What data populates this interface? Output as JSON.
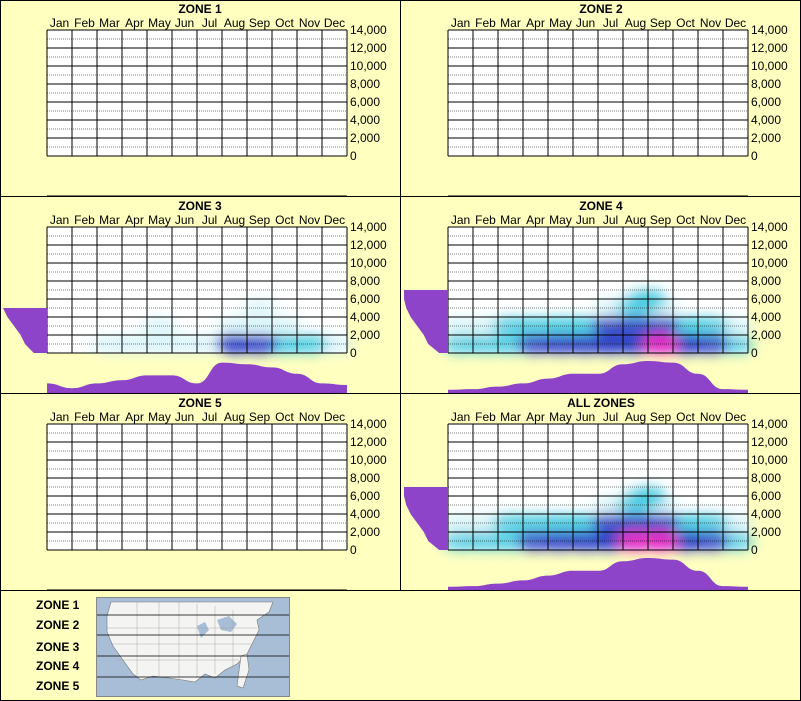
{
  "months": [
    "Jan",
    "Feb",
    "Mar",
    "Apr",
    "May",
    "Jun",
    "Jul",
    "Aug",
    "Sep",
    "Oct",
    "Nov",
    "Dec"
  ],
  "y_ticks": [
    "14,000",
    "12,000",
    "10,000",
    "8,000",
    "6,000",
    "4,000",
    "2,000",
    "0"
  ],
  "colors": {
    "background": "#ffffc0",
    "density_profile": "#8e44c8",
    "heat_low": "#cdf1f6",
    "heat_mid": "#2ec4dc",
    "heat_high": "#1a2fc0",
    "heat_peak": "#e020c0"
  },
  "legend": {
    "zones": [
      "ZONE 1",
      "ZONE 2",
      "ZONE 3",
      "ZONE 4",
      "ZONE 5"
    ]
  },
  "chart_data": [
    {
      "type": "heatmap",
      "title": "ZONE 1",
      "x": [
        "Jan",
        "Feb",
        "Mar",
        "Apr",
        "May",
        "Jun",
        "Jul",
        "Aug",
        "Sep",
        "Oct",
        "Nov",
        "Dec"
      ],
      "ylim": [
        0,
        14000
      ],
      "cells": [],
      "elevation_profile": [],
      "month_profile": []
    },
    {
      "type": "heatmap",
      "title": "ZONE 2",
      "x": [
        "Jan",
        "Feb",
        "Mar",
        "Apr",
        "May",
        "Jun",
        "Jul",
        "Aug",
        "Sep",
        "Oct",
        "Nov",
        "Dec"
      ],
      "ylim": [
        0,
        14000
      ],
      "cells": [],
      "elevation_profile": [],
      "month_profile": []
    },
    {
      "type": "heatmap",
      "title": "ZONE 3",
      "x": [
        "Jan",
        "Feb",
        "Mar",
        "Apr",
        "May",
        "Jun",
        "Jul",
        "Aug",
        "Sep",
        "Oct",
        "Nov",
        "Dec"
      ],
      "ylim": [
        0,
        14000
      ],
      "cells": [
        {
          "month": 2.5,
          "elev": 1000,
          "i": 0.25
        },
        {
          "month": 3.5,
          "elev": 1000,
          "i": 0.25
        },
        {
          "month": 4.5,
          "elev": 1000,
          "i": 0.3
        },
        {
          "month": 5.5,
          "elev": 1000,
          "i": 0.25
        },
        {
          "month": 6.5,
          "elev": 1000,
          "i": 0.25
        },
        {
          "month": 7.5,
          "elev": 1000,
          "i": 0.8
        },
        {
          "month": 8.5,
          "elev": 1000,
          "i": 0.65
        },
        {
          "month": 9.5,
          "elev": 1000,
          "i": 0.55
        },
        {
          "month": 10.5,
          "elev": 1000,
          "i": 0.45
        },
        {
          "month": 11.5,
          "elev": 1000,
          "i": 0.3
        },
        {
          "month": 4.5,
          "elev": 3000,
          "i": 0.12
        },
        {
          "month": 7.5,
          "elev": 3000,
          "i": 0.25
        },
        {
          "month": 8.5,
          "elev": 3000,
          "i": 0.25
        },
        {
          "month": 9.5,
          "elev": 3000,
          "i": 0.2
        },
        {
          "month": 8.5,
          "elev": 5000,
          "i": 0.1
        }
      ],
      "elevation_profile": [
        [
          0,
          0.3
        ],
        [
          1000,
          0.5
        ],
        [
          2000,
          0.6
        ],
        [
          3000,
          0.75
        ],
        [
          4000,
          0.9
        ],
        [
          5000,
          1.0
        ]
      ],
      "month_profile": [
        [
          0,
          0.3
        ],
        [
          1,
          0.15
        ],
        [
          2,
          0.3
        ],
        [
          3,
          0.4
        ],
        [
          4,
          0.55
        ],
        [
          5,
          0.55
        ],
        [
          6,
          0.3
        ],
        [
          7,
          0.95
        ],
        [
          8,
          0.9
        ],
        [
          9,
          0.8
        ],
        [
          10,
          0.6
        ],
        [
          11,
          0.3
        ],
        [
          12,
          0.25
        ]
      ]
    },
    {
      "type": "heatmap",
      "title": "ZONE 4",
      "x": [
        "Jan",
        "Feb",
        "Mar",
        "Apr",
        "May",
        "Jun",
        "Jul",
        "Aug",
        "Sep",
        "Oct",
        "Nov",
        "Dec"
      ],
      "ylim": [
        0,
        14000
      ],
      "cells": [
        {
          "month": 0.5,
          "elev": 3000,
          "i": 0.3
        },
        {
          "month": 1.5,
          "elev": 3000,
          "i": 0.3
        },
        {
          "month": 2.5,
          "elev": 3000,
          "i": 0.35
        },
        {
          "month": 3.5,
          "elev": 3000,
          "i": 0.4
        },
        {
          "month": 4.5,
          "elev": 3000,
          "i": 0.5
        },
        {
          "month": 5.5,
          "elev": 3000,
          "i": 0.55
        },
        {
          "month": 6.5,
          "elev": 3000,
          "i": 0.6
        },
        {
          "month": 7.5,
          "elev": 3000,
          "i": 0.6
        },
        {
          "month": 8.5,
          "elev": 3000,
          "i": 0.6
        },
        {
          "month": 9.5,
          "elev": 3000,
          "i": 0.55
        },
        {
          "month": 10.5,
          "elev": 3000,
          "i": 0.4
        },
        {
          "month": 11.5,
          "elev": 3000,
          "i": 0.3
        },
        {
          "month": 0.5,
          "elev": 1000,
          "i": 0.4
        },
        {
          "month": 1.5,
          "elev": 1000,
          "i": 0.4
        },
        {
          "month": 2.5,
          "elev": 1000,
          "i": 0.5
        },
        {
          "month": 3.5,
          "elev": 1000,
          "i": 0.6
        },
        {
          "month": 4.5,
          "elev": 1000,
          "i": 0.7
        },
        {
          "month": 5.5,
          "elev": 1000,
          "i": 0.75
        },
        {
          "month": 6.5,
          "elev": 1000,
          "i": 0.85
        },
        {
          "month": 7.5,
          "elev": 1000,
          "i": 0.9
        },
        {
          "month": 8.5,
          "elev": 1000,
          "i": 1.0
        },
        {
          "month": 9.5,
          "elev": 1000,
          "i": 0.9
        },
        {
          "month": 10.5,
          "elev": 1000,
          "i": 0.6
        },
        {
          "month": 11.5,
          "elev": 1000,
          "i": 0.4
        },
        {
          "month": 6.5,
          "elev": 5000,
          "i": 0.3
        },
        {
          "month": 7.5,
          "elev": 5000,
          "i": 0.35
        },
        {
          "month": 8.5,
          "elev": 5000,
          "i": 0.3
        },
        {
          "month": 7.5,
          "elev": 6000,
          "i": 0.25
        },
        {
          "month": 8.0,
          "elev": 6000,
          "i": 0.55
        }
      ],
      "elevation_profile": [
        [
          0,
          0.2
        ],
        [
          1000,
          0.45
        ],
        [
          2000,
          0.55
        ],
        [
          3000,
          0.7
        ],
        [
          4000,
          0.85
        ],
        [
          5000,
          0.95
        ],
        [
          6000,
          1.0
        ],
        [
          7000,
          1.0
        ]
      ],
      "month_profile": [
        [
          0,
          0.1
        ],
        [
          1,
          0.12
        ],
        [
          2,
          0.2
        ],
        [
          3,
          0.3
        ],
        [
          4,
          0.45
        ],
        [
          5,
          0.6
        ],
        [
          6,
          0.6
        ],
        [
          7,
          0.9
        ],
        [
          8,
          1.0
        ],
        [
          9,
          0.95
        ],
        [
          10,
          0.6
        ],
        [
          11,
          0.12
        ],
        [
          12,
          0.1
        ]
      ]
    },
    {
      "type": "heatmap",
      "title": "ZONE 5",
      "x": [
        "Jan",
        "Feb",
        "Mar",
        "Apr",
        "May",
        "Jun",
        "Jul",
        "Aug",
        "Sep",
        "Oct",
        "Nov",
        "Dec"
      ],
      "ylim": [
        0,
        14000
      ],
      "cells": [],
      "elevation_profile": [],
      "month_profile": []
    },
    {
      "type": "heatmap",
      "title": "ALL ZONES",
      "x": [
        "Jan",
        "Feb",
        "Mar",
        "Apr",
        "May",
        "Jun",
        "Jul",
        "Aug",
        "Sep",
        "Oct",
        "Nov",
        "Dec"
      ],
      "ylim": [
        0,
        14000
      ],
      "cells": [
        {
          "month": 0.5,
          "elev": 3000,
          "i": 0.3
        },
        {
          "month": 1.5,
          "elev": 3000,
          "i": 0.3
        },
        {
          "month": 2.5,
          "elev": 3000,
          "i": 0.35
        },
        {
          "month": 3.5,
          "elev": 3000,
          "i": 0.4
        },
        {
          "month": 4.5,
          "elev": 3000,
          "i": 0.5
        },
        {
          "month": 5.5,
          "elev": 3000,
          "i": 0.55
        },
        {
          "month": 6.5,
          "elev": 3000,
          "i": 0.6
        },
        {
          "month": 7.5,
          "elev": 3000,
          "i": 0.6
        },
        {
          "month": 8.5,
          "elev": 3000,
          "i": 0.6
        },
        {
          "month": 9.5,
          "elev": 3000,
          "i": 0.55
        },
        {
          "month": 10.5,
          "elev": 3000,
          "i": 0.4
        },
        {
          "month": 11.5,
          "elev": 3000,
          "i": 0.3
        },
        {
          "month": 0.5,
          "elev": 1000,
          "i": 0.4
        },
        {
          "month": 1.5,
          "elev": 1000,
          "i": 0.4
        },
        {
          "month": 2.5,
          "elev": 1000,
          "i": 0.5
        },
        {
          "month": 3.5,
          "elev": 1000,
          "i": 0.6
        },
        {
          "month": 4.5,
          "elev": 1000,
          "i": 0.7
        },
        {
          "month": 5.5,
          "elev": 1000,
          "i": 0.75
        },
        {
          "month": 6.5,
          "elev": 1000,
          "i": 0.85
        },
        {
          "month": 7.5,
          "elev": 1000,
          "i": 0.95
        },
        {
          "month": 8.5,
          "elev": 1000,
          "i": 1.0
        },
        {
          "month": 9.5,
          "elev": 1000,
          "i": 0.9
        },
        {
          "month": 10.5,
          "elev": 1000,
          "i": 0.6
        },
        {
          "month": 11.5,
          "elev": 1000,
          "i": 0.4
        },
        {
          "month": 6.5,
          "elev": 5000,
          "i": 0.3
        },
        {
          "month": 7.5,
          "elev": 5000,
          "i": 0.35
        },
        {
          "month": 8.5,
          "elev": 5000,
          "i": 0.3
        },
        {
          "month": 7.5,
          "elev": 6000,
          "i": 0.25
        },
        {
          "month": 8.0,
          "elev": 6000,
          "i": 0.55
        }
      ],
      "elevation_profile": [
        [
          0,
          0.2
        ],
        [
          1000,
          0.45
        ],
        [
          2000,
          0.55
        ],
        [
          3000,
          0.7
        ],
        [
          4000,
          0.85
        ],
        [
          5000,
          0.95
        ],
        [
          6000,
          1.0
        ],
        [
          7000,
          1.0
        ]
      ],
      "month_profile": [
        [
          0,
          0.1
        ],
        [
          1,
          0.12
        ],
        [
          2,
          0.2
        ],
        [
          3,
          0.3
        ],
        [
          4,
          0.45
        ],
        [
          5,
          0.6
        ],
        [
          6,
          0.6
        ],
        [
          7,
          0.9
        ],
        [
          8,
          1.0
        ],
        [
          9,
          0.95
        ],
        [
          10,
          0.6
        ],
        [
          11,
          0.12
        ],
        [
          12,
          0.1
        ]
      ]
    }
  ]
}
